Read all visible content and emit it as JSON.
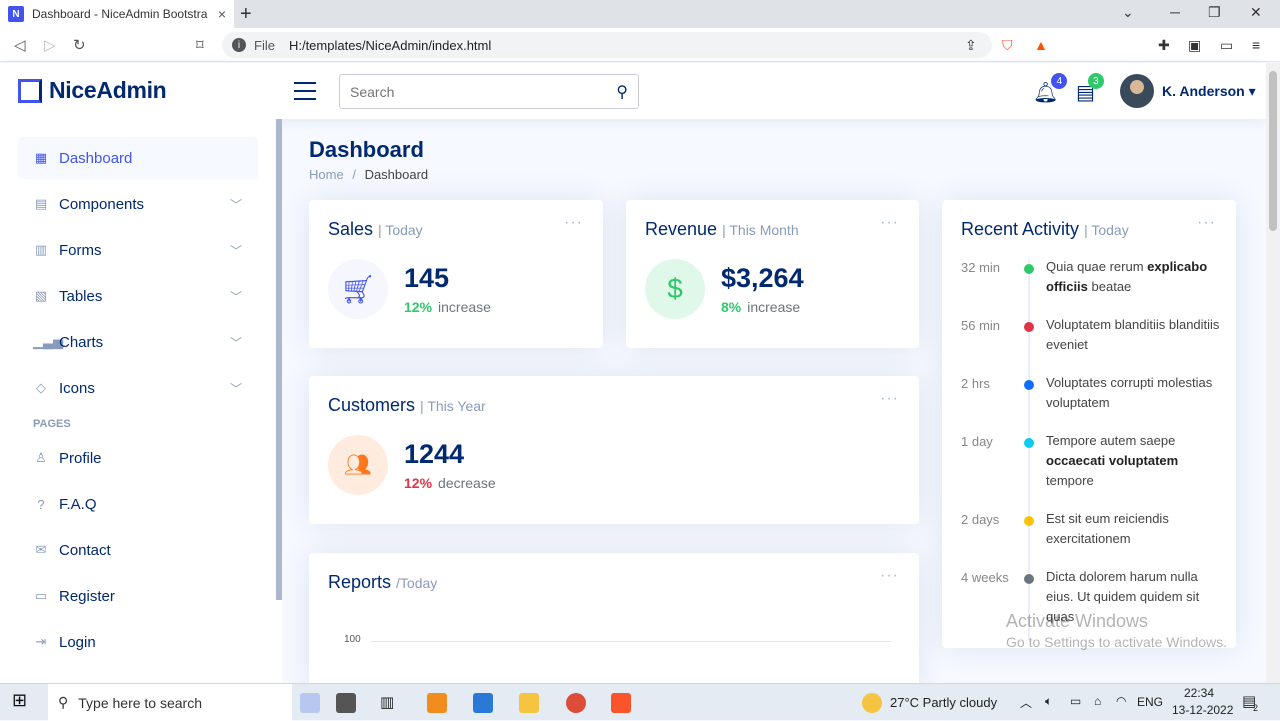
{
  "browser": {
    "tab_title": "Dashboard - NiceAdmin Bootstra",
    "tab_close": "×",
    "new_tab": "+",
    "file_label": "File",
    "url": "H:/templates/NiceAdmin/index.html"
  },
  "header": {
    "logo_text": "NiceAdmin",
    "search_placeholder": "Search",
    "notifications_count": "4",
    "messages_count": "3",
    "user_name": "K. Anderson",
    "colors": {
      "accent": "#4154f1",
      "brand": "#012970",
      "notif": "#4154f1",
      "messages": "#2eca6a"
    }
  },
  "sidebar": {
    "items": [
      {
        "label": "Dashboard",
        "icon": "grid-icon",
        "active": true
      },
      {
        "label": "Components",
        "icon": "menu-button-icon",
        "expandable": true
      },
      {
        "label": "Forms",
        "icon": "journal-text-icon",
        "expandable": true
      },
      {
        "label": "Tables",
        "icon": "layout-text-icon",
        "expandable": true
      },
      {
        "label": "Charts",
        "icon": "bar-chart-icon",
        "expandable": true
      },
      {
        "label": "Icons",
        "icon": "gem-icon",
        "expandable": true
      }
    ],
    "pages_heading": "PAGES",
    "pages": [
      {
        "label": "Profile",
        "icon": "person-icon"
      },
      {
        "label": "F.A.Q",
        "icon": "question-circle-icon"
      },
      {
        "label": "Contact",
        "icon": "envelope-icon"
      },
      {
        "label": "Register",
        "icon": "card-list-icon"
      },
      {
        "label": "Login",
        "icon": "box-arrow-in-right-icon"
      }
    ]
  },
  "main": {
    "page_title": "Dashboard",
    "breadcrumb": {
      "home": "Home",
      "sep": "/",
      "current": "Dashboard"
    },
    "sales": {
      "title": "Sales",
      "period": "| Today",
      "value": "145",
      "pct": "12%",
      "trend": "increase"
    },
    "revenue": {
      "title": "Revenue",
      "period": "| This Month",
      "value": "$3,264",
      "pct": "8%",
      "trend": "increase"
    },
    "customers": {
      "title": "Customers",
      "period": "| This Year",
      "value": "1244",
      "pct": "12%",
      "trend": "decrease"
    },
    "reports": {
      "title": "Reports",
      "period": "/Today",
      "ytick_top": "100"
    },
    "activity": {
      "title": "Recent Activity",
      "period": "| Today",
      "items": [
        {
          "time": "32 min",
          "color": "#2eca6a",
          "pre": "Quia quae rerum ",
          "bold": "explicabo officiis",
          "post": " beatae"
        },
        {
          "time": "56 min",
          "color": "#dc3545",
          "pre": "Voluptatem blanditiis blanditiis eveniet",
          "bold": "",
          "post": ""
        },
        {
          "time": "2 hrs",
          "color": "#0d6efd",
          "pre": "Voluptates corrupti molestias voluptatem",
          "bold": "",
          "post": ""
        },
        {
          "time": "1 day",
          "color": "#0dcaf0",
          "pre": "Tempore autem saepe ",
          "bold": "occaecati voluptatem",
          "post": " tempore"
        },
        {
          "time": "2 days",
          "color": "#ffc107",
          "pre": "Est sit eum reiciendis exercitationem",
          "bold": "",
          "post": ""
        },
        {
          "time": "4 weeks",
          "color": "#6c757d",
          "pre": "Dicta dolorem harum nulla eius. Ut quidem quidem sit quas",
          "bold": "",
          "post": ""
        }
      ]
    },
    "dots": "···",
    "status_colors": {
      "increase": "#2eca6a",
      "decrease": "#dc3545"
    }
  },
  "watermark": {
    "line1": "Activate Windows",
    "line2": "Go to Settings to activate Windows."
  },
  "taskbar": {
    "search_placeholder": "Type here to search",
    "weather": "27°C  Partly cloudy",
    "language": "ENG",
    "time": "22:34",
    "date": "13-12-2022",
    "notif_count": "2"
  }
}
